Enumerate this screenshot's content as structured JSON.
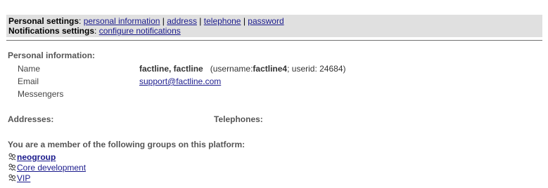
{
  "settings": {
    "personal_label": "Personal settings",
    "links": [
      "personal information",
      "address",
      "telephone",
      "password"
    ],
    "separator": "|",
    "notifications_label": "Notifications settings",
    "notifications_link": "configure notifications"
  },
  "personal_info": {
    "heading": "Personal information:",
    "name_label": "Name",
    "name_value": "factline, factline",
    "username_prefix": "(username:",
    "username": "factline4",
    "userid_text": "; userid: 24684)",
    "email_label": "Email",
    "email_value": "support@factline.com",
    "messengers_label": "Messengers"
  },
  "addresses_heading": "Addresses:",
  "telephones_heading": "Telephones:",
  "groups": {
    "heading": "You are a member of the following groups on this platform:",
    "items": [
      {
        "label": "neogroup",
        "bold": true
      },
      {
        "label": "Core development",
        "bold": false
      },
      {
        "label": "VIP",
        "bold": false
      }
    ],
    "icon": "group-icon"
  },
  "colors": {
    "bar_bg": "#e0e0e0",
    "link": "#1a1a8c"
  }
}
